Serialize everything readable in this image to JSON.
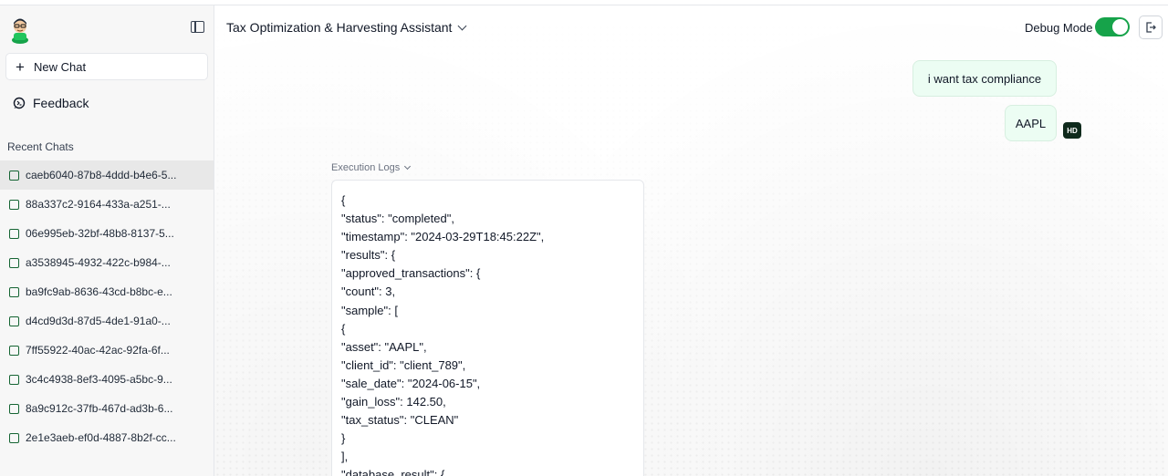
{
  "sidebar": {
    "new_chat_label": "New Chat",
    "feedback_label": "Feedback",
    "recent_title": "Recent Chats",
    "chats": [
      "caeb6040-87b8-4ddd-b4e6-5...",
      "88a337c2-9164-433a-a251-...",
      "06e995eb-32bf-48b8-8137-5...",
      "a3538945-4932-422c-b984-...",
      "ba9fc9ab-8636-43cd-b8bc-e...",
      "d4cd9d3d-87d5-4de1-91a0-...",
      "7ff55922-40ac-42ac-92fa-6f...",
      "3c4c4938-8ef3-4095-a5bc-9...",
      "8a9c912c-37fb-467d-ad3b-6...",
      "2e1e3aeb-ef0d-4887-8b2f-cc..."
    ]
  },
  "header": {
    "title": "Tax Optimization & Harvesting Assistant",
    "debug_label": "Debug Mode",
    "debug_on": true
  },
  "messages": {
    "user_1": "i want tax compliance",
    "user_2": "AAPL",
    "user_initials": "HD"
  },
  "logs": {
    "label": "Execution Logs",
    "lines": [
      "{",
      "\"status\": \"completed\",",
      "\"timestamp\": \"2024-03-29T18:45:22Z\",",
      "\"results\": {",
      "\"approved_transactions\": {",
      "\"count\": 3,",
      "\"sample\": [",
      "{",
      "\"asset\": \"AAPL\",",
      "\"client_id\": \"client_789\",",
      "\"sale_date\": \"2024-06-15\",",
      "\"gain_loss\": 142.50,",
      "\"tax_status\": \"CLEAN\"",
      "}",
      "],",
      "\"database_result\": {"
    ]
  },
  "colors": {
    "accent": "#16a34a",
    "bubble_bg": "#ecfdf3",
    "badge_bg": "#0f2a1c"
  }
}
